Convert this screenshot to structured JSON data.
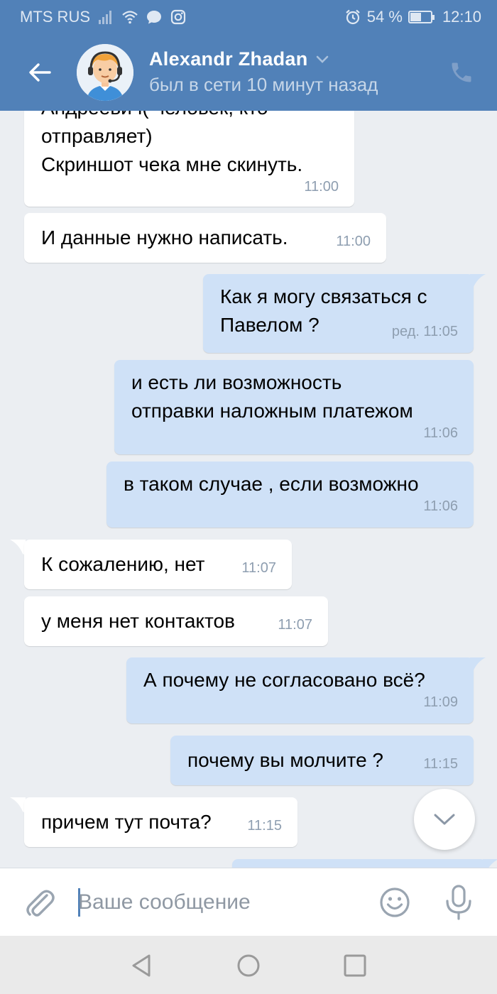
{
  "status_bar": {
    "carrier": "MTS RUS",
    "battery": "54 %",
    "battery_level": 0.54,
    "time": "12:10",
    "icons": [
      "signal-icon",
      "wifi-icon",
      "chat-bubble-icon",
      "instagram-icon",
      "alarm-icon",
      "battery-icon"
    ]
  },
  "header": {
    "contact_name": "Alexandr Zhadan",
    "contact_status": "был в сети 10 минут назад",
    "icons": [
      "back-arrow-icon",
      "chevron-down-icon",
      "phone-icon"
    ]
  },
  "messages": [
    {
      "direction": "in",
      "text_lines": [
        "Андреевич( человек, кто",
        "отправляет)",
        "Скриншот чека мне скинуть."
      ],
      "time": "11:00"
    },
    {
      "direction": "in",
      "text_lines": [
        "И данные нужно написать."
      ],
      "time": "11:00"
    },
    {
      "direction": "out",
      "text_lines": [
        "Как я могу связаться с",
        "Павелом ?"
      ],
      "time": "ред. 11:05"
    },
    {
      "direction": "out",
      "text_lines": [
        "и есть ли возможность",
        "отправки наложным платежом"
      ],
      "time": "11:06"
    },
    {
      "direction": "out",
      "text_lines": [
        "в таком случае , если возможно"
      ],
      "time": "11:06"
    },
    {
      "direction": "in",
      "text_lines": [
        "К сожалению, нет"
      ],
      "time": "11:07"
    },
    {
      "direction": "in",
      "text_lines": [
        "у меня нет контактов"
      ],
      "time": "11:07"
    },
    {
      "direction": "out",
      "text_lines": [
        "А почему не согласовано всё?"
      ],
      "time": "11:09"
    },
    {
      "direction": "out",
      "text_lines": [
        "почему вы молчите ?"
      ],
      "time": "11:15"
    },
    {
      "direction": "in",
      "text_lines": [
        "причем тут почта?"
      ],
      "time": "11:15"
    }
  ],
  "composer": {
    "placeholder": "Ваше сообщение",
    "value": "",
    "icons": [
      "paperclip-icon",
      "emoji-icon",
      "microphone-icon"
    ]
  },
  "scroll_down": {
    "icon": "chevron-down-icon"
  },
  "nav_bar": {
    "icons": [
      "nav-back-icon",
      "nav-home-icon",
      "nav-recents-icon"
    ]
  },
  "colors": {
    "header": "#5181b8",
    "background": "#ebeef2",
    "outgoing_bubble": "#cfe1f7",
    "incoming_bubble": "#ffffff",
    "time_text": "#8e9eb0"
  }
}
